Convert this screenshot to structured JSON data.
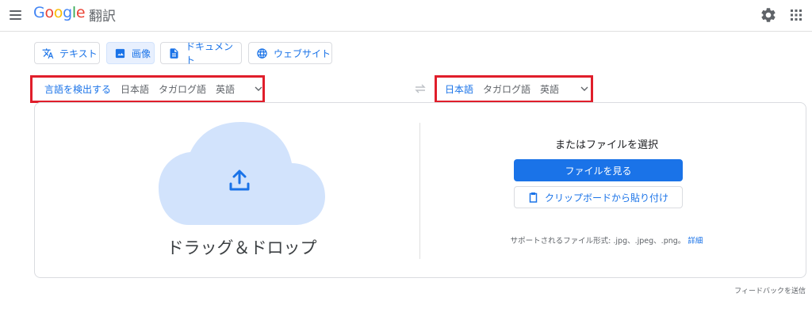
{
  "header": {
    "brand_letters": [
      "G",
      "o",
      "o",
      "g",
      "l",
      "e"
    ],
    "product": "翻訳"
  },
  "modes": [
    {
      "label": "テキスト",
      "icon": "translate-icon",
      "active": false
    },
    {
      "label": "画像",
      "icon": "image-icon",
      "active": true
    },
    {
      "label": "ドキュメント",
      "icon": "document-icon",
      "active": false
    },
    {
      "label": "ウェブサイト",
      "icon": "globe-icon",
      "active": false
    }
  ],
  "source_langs": [
    "言語を検出する",
    "日本語",
    "タガログ語",
    "英語"
  ],
  "source_selected_index": 0,
  "target_langs": [
    "日本語",
    "タガログ語",
    "英語"
  ],
  "target_selected_index": 0,
  "upload": {
    "drop_text": "ドラッグ＆ドロップ",
    "or_text": "またはファイルを選択",
    "browse_button": "ファイルを見る",
    "clipboard_button": "クリップボードから貼り付け",
    "formats_text": "サポートされるファイル形式: .jpg、.jpeg、.png。",
    "formats_more": "詳細"
  },
  "footer": {
    "feedback": "フィードバックを送信"
  },
  "colors": {
    "accent": "#1a73e8",
    "highlight_box": "#e01e2b",
    "cloud": "#d2e3fc"
  }
}
